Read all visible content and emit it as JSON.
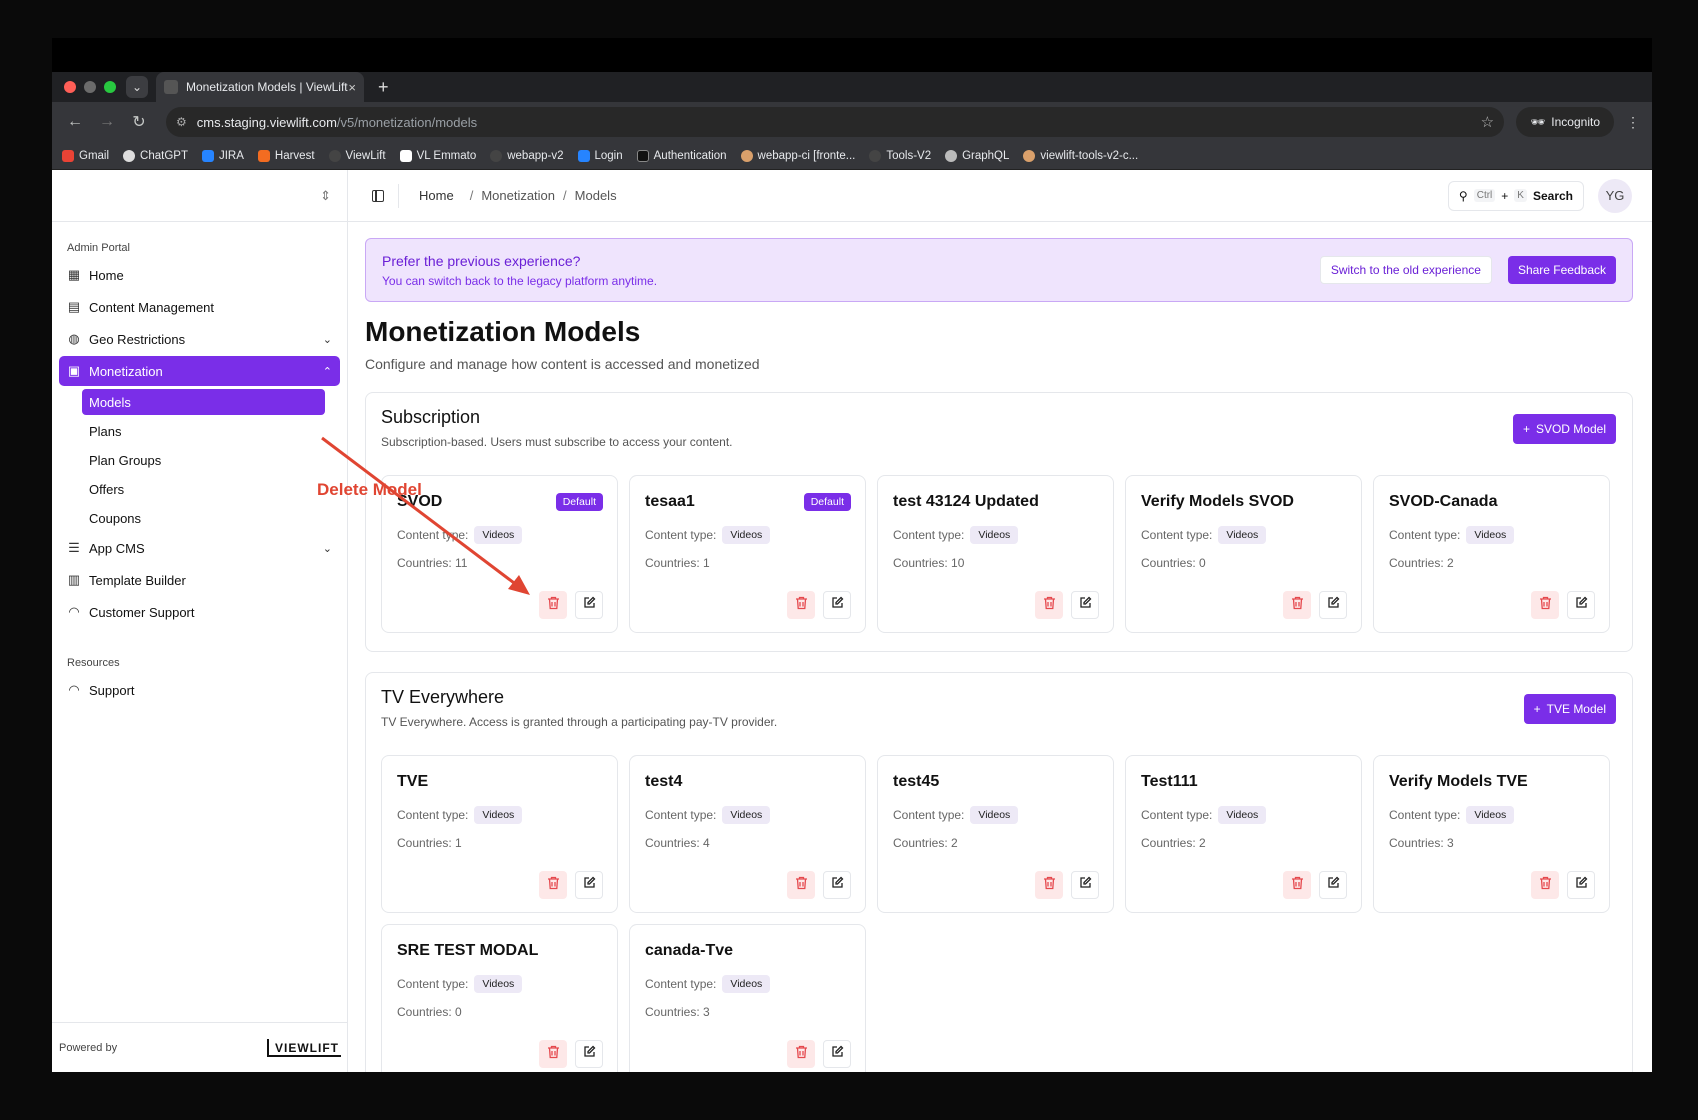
{
  "browser": {
    "tab_title": "Monetization Models | ViewLift",
    "tab_close": "×",
    "new_tab": "+",
    "url_host": "cms.staging.viewlift.com",
    "url_path": "/v5/monetization/models",
    "incognito_label": "Incognito",
    "bookmarks": [
      "Gmail",
      "ChatGPT",
      "JIRA",
      "Harvest",
      "ViewLift",
      "VL Emmato",
      "webapp-v2",
      "Login",
      "Authentication",
      "webapp-ci [fronte...",
      "Tools-V2",
      "GraphQL",
      "viewlift-tools-v2-c..."
    ]
  },
  "sidebar": {
    "section_admin": "Admin Portal",
    "items": [
      {
        "label": "Home",
        "icon": "dashboard-icon"
      },
      {
        "label": "Content Management",
        "icon": "film-icon"
      },
      {
        "label": "Geo Restrictions",
        "icon": "globe-icon"
      },
      {
        "label": "Monetization",
        "icon": "wallet-icon"
      },
      {
        "label": "App CMS",
        "icon": "sliders-icon"
      },
      {
        "label": "Template Builder",
        "icon": "layout-icon"
      },
      {
        "label": "Customer Support",
        "icon": "headset-icon"
      }
    ],
    "sub_items": [
      "Models",
      "Plans",
      "Plan Groups",
      "Offers",
      "Coupons"
    ],
    "section_resources": "Resources",
    "support_label": "Support",
    "powered_by": "Powered by",
    "logo_text": "VIEWLIFT"
  },
  "topbar": {
    "crumb_home": "Home",
    "crumb_1": "Monetization",
    "crumb_2": "Models",
    "crumb_sep": "/",
    "kbd_ctrl": "Ctrl",
    "kbd_plus": "+",
    "kbd_k": "K",
    "search_label": "Search",
    "avatar": "YG"
  },
  "banner": {
    "title": "Prefer the previous experience?",
    "subtitle": "You can switch back to the legacy platform anytime.",
    "switch_label": "Switch to the old experience",
    "feedback_label": "Share Feedback"
  },
  "page": {
    "title": "Monetization Models",
    "subtitle": "Configure and manage how content is accessed and monetized"
  },
  "content_type_label": "Content type:",
  "subscription": {
    "title": "Subscription",
    "description": "Subscription-based. Users must subscribe to access your content.",
    "add_label": "SVOD Model",
    "cards": [
      {
        "name": "SVOD",
        "badge": "Default",
        "type": "Videos",
        "countries": "Countries: 11"
      },
      {
        "name": "tesaa1",
        "badge": "Default",
        "type": "Videos",
        "countries": "Countries: 1"
      },
      {
        "name": "test 43124 Updated",
        "badge": "",
        "type": "Videos",
        "countries": "Countries: 10"
      },
      {
        "name": "Verify Models SVOD",
        "badge": "",
        "type": "Videos",
        "countries": "Countries: 0"
      },
      {
        "name": "SVOD-Canada",
        "badge": "",
        "type": "Videos",
        "countries": "Countries: 2"
      }
    ]
  },
  "tve": {
    "title": "TV Everywhere",
    "description": "TV Everywhere. Access is granted through a participating pay-TV provider.",
    "add_label": "TVE Model",
    "cards": [
      {
        "name": "TVE",
        "type": "Videos",
        "countries": "Countries: 1"
      },
      {
        "name": "test4",
        "type": "Videos",
        "countries": "Countries: 4"
      },
      {
        "name": "test45",
        "type": "Videos",
        "countries": "Countries: 2"
      },
      {
        "name": "Test111",
        "type": "Videos",
        "countries": "Countries: 2"
      },
      {
        "name": "Verify Models TVE",
        "type": "Videos",
        "countries": "Countries: 3"
      },
      {
        "name": "SRE TEST MODAL",
        "type": "Videos",
        "countries": "Countries: 0"
      },
      {
        "name": "canada-Tve",
        "type": "Videos",
        "countries": "Countries: 3"
      }
    ]
  },
  "annotation": {
    "label": "Delete Model",
    "color": "#e04532"
  },
  "colors": {
    "accent": "#7a2ee8",
    "delete_bg": "#fde8e8",
    "delete_icon": "#e5484d"
  }
}
